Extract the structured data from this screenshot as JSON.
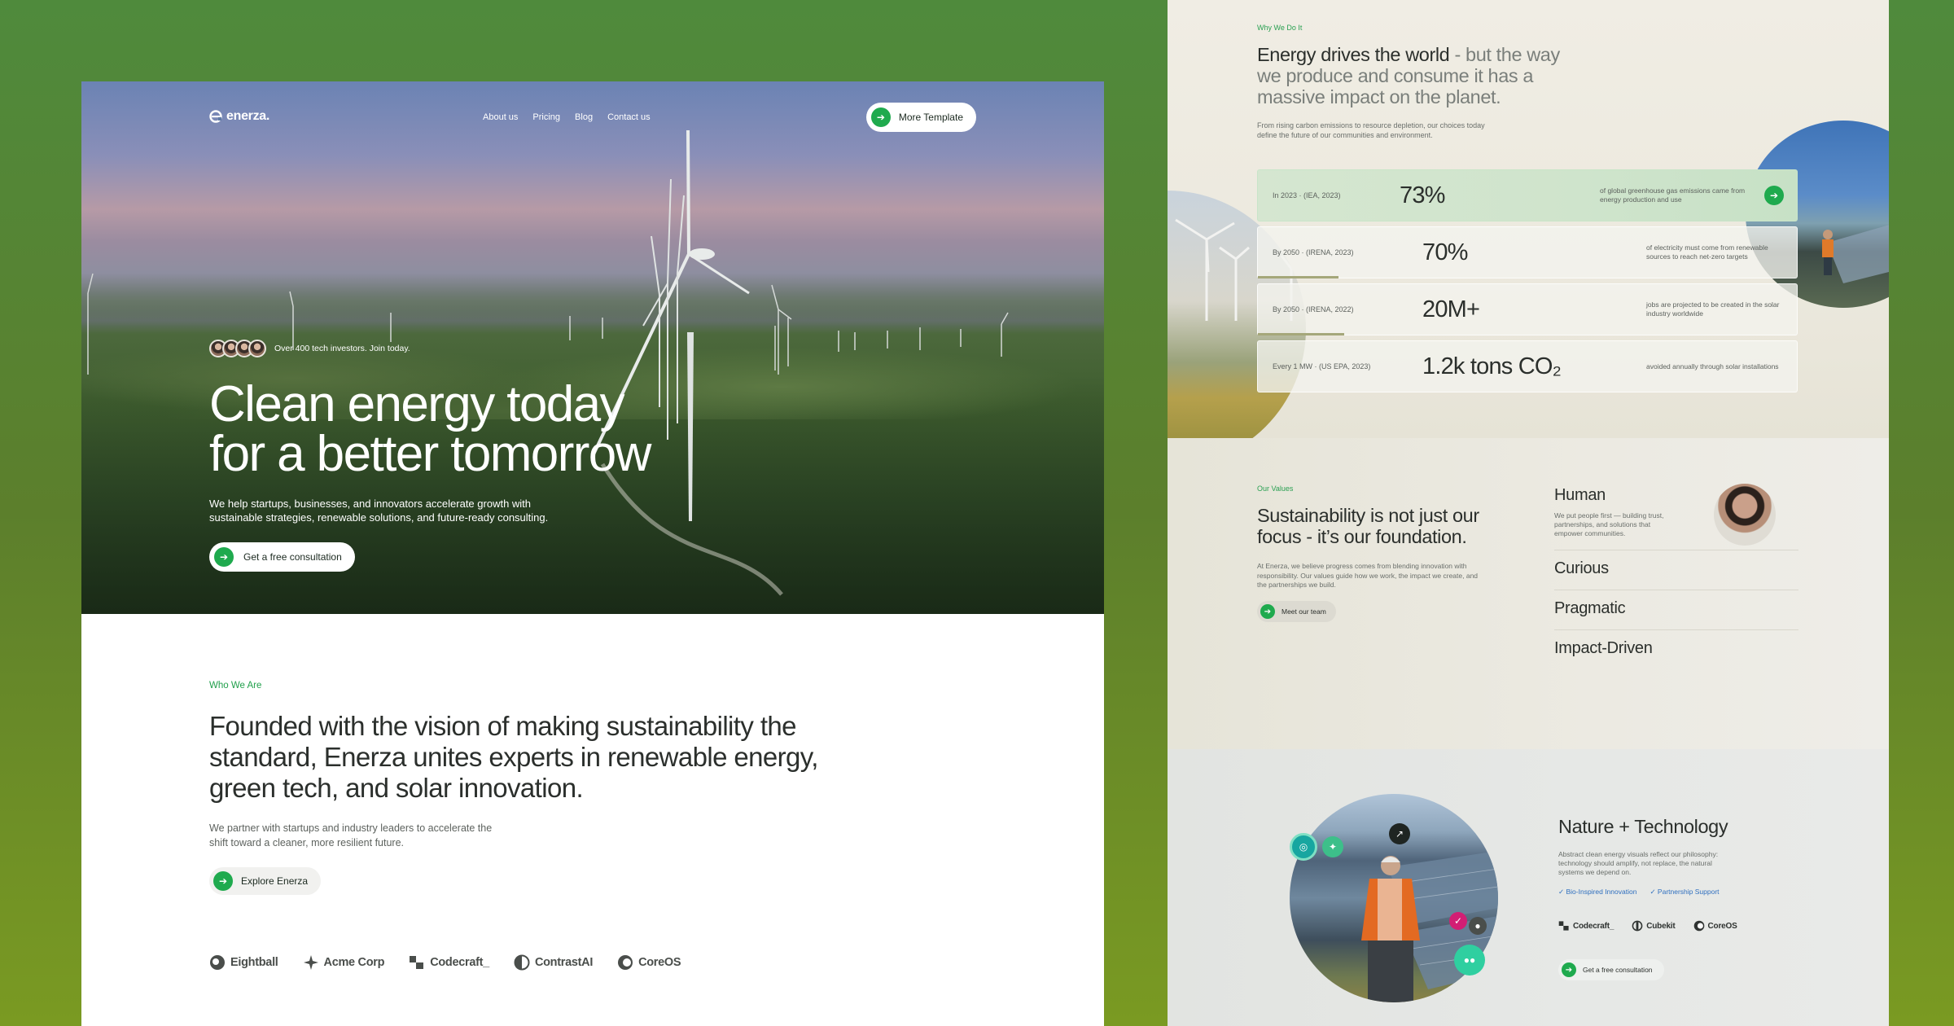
{
  "colors": {
    "accent": "#1faa4e",
    "background": "#5c7f2c",
    "kicker": "#1f9f4a",
    "link": "#2f6fbf"
  },
  "hero": {
    "logo_text": "enerza.",
    "nav": [
      "About us",
      "Pricing",
      "Blog",
      "Contact us"
    ],
    "nav_cta": "More Template",
    "investors_text": "Over 400 tech investors. Join today.",
    "title_line1": "Clean energy today",
    "title_line2": "for a better tomorrow",
    "description": "We help startups, businesses, and innovators accelerate growth with sustainable strategies, renewable solutions, and future-ready consulting.",
    "cta": "Get a free consultation",
    "arrow_icon": "arrow-right-icon"
  },
  "about": {
    "kicker": "Who We Are",
    "title": "Founded with the vision of making sustainability the standard, Enerza unites experts in renewable energy, green tech, and solar innovation.",
    "description": "We partner with startups and industry leaders to accelerate the shift toward a cleaner, more resilient future.",
    "cta": "Explore Enerza",
    "brands": [
      {
        "name": "Eightball",
        "icon": "eightball-logo-icon"
      },
      {
        "name": "Acme Corp",
        "icon": "acme-star-icon"
      },
      {
        "name": "Codecraft_",
        "icon": "codecraft-blocks-icon"
      },
      {
        "name": "ContrastAI",
        "icon": "contrast-circle-icon"
      },
      {
        "name": "CoreOS",
        "icon": "coreos-circle-icon"
      }
    ]
  },
  "why": {
    "kicker": "Why We Do It",
    "title_strong": "Energy drives the world",
    "title_muted": " - but the way we produce and consume it has a massive impact on the planet.",
    "description": "From rising carbon emissions to resource depletion, our choices today define the future of our communities and environment.",
    "stats": [
      {
        "label": "In 2023  ·  (IEA, 2023)",
        "value": "73%",
        "desc": "of global greenhouse gas emissions came from energy production and use",
        "active": true,
        "progress": 1.0
      },
      {
        "label": "By 2050  ·  (IRENA, 2023)",
        "value": "70%",
        "desc": "of electricity must come from renewable sources to reach net-zero targets",
        "active": false,
        "progress": 0.15
      },
      {
        "label": "By 2050  ·  (IRENA, 2022)",
        "value": "20M+",
        "desc": "jobs are projected to be created in the solar industry worldwide",
        "active": false,
        "progress": 0.16
      },
      {
        "label": "Every 1 MW  ·  (US EPA, 2023)",
        "value": "1.2k tons CO₂",
        "desc": "avoided annually through solar installations",
        "active": false,
        "progress": 0.0
      }
    ]
  },
  "values": {
    "kicker": "Our Values",
    "title": "Sustainability is not just our focus - it’s our foundation.",
    "description": "At Enerza, we believe progress comes from blending innovation with responsibility. Our values guide how we work, the impact we create, and the partnerships we build.",
    "cta": "Meet our team",
    "items": [
      {
        "name": "Human",
        "text": "We put people first — building trust, partnerships, and solutions that empower communities."
      },
      {
        "name": "Curious",
        "text": ""
      },
      {
        "name": "Pragmatic",
        "text": ""
      },
      {
        "name": "Impact-Driven",
        "text": ""
      }
    ]
  },
  "nature": {
    "title": "Nature + Technology",
    "description": "Abstract clean energy visuals reflect our philosophy: technology should amplify, not replace, the natural systems we depend on.",
    "tags": [
      "✓ Bio-Inspired Innovation",
      "✓ Partnership Support"
    ],
    "brands": [
      {
        "name": "Codecraft_",
        "icon": "codecraft-blocks-icon"
      },
      {
        "name": "Cubekit",
        "icon": "cubekit-icon"
      },
      {
        "name": "CoreOS",
        "icon": "coreos-circle-icon"
      }
    ],
    "cta": "Get a free consultation"
  }
}
